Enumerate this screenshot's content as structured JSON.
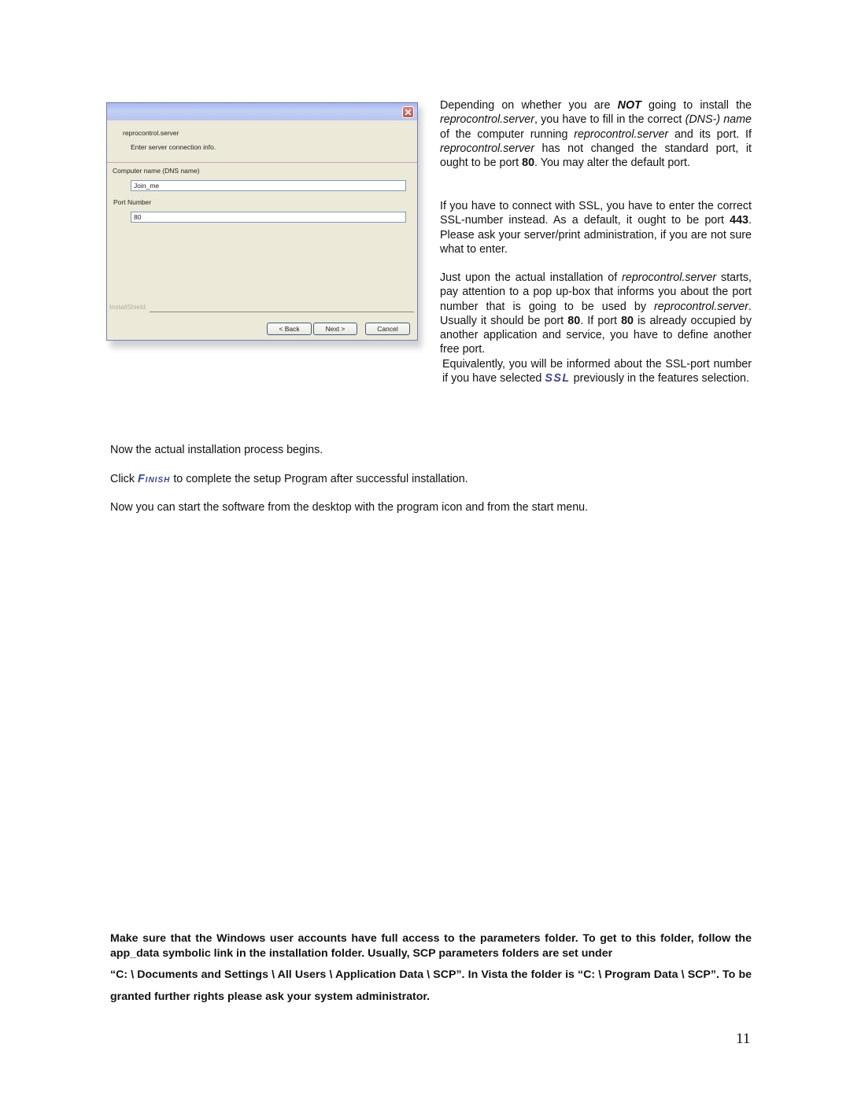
{
  "dialog": {
    "title": "reprocontrol.server",
    "subtitle": "Enter server connection info.",
    "dns_label": "Computer name (DNS name)",
    "dns_value": "Join_me",
    "port_label": "Port Number",
    "port_value": "80",
    "brand": "InstallShield",
    "back_label": "< Back",
    "next_label": "Next >",
    "cancel_label": "Cancel",
    "close_glyph": "✕"
  },
  "right_column": {
    "p1": {
      "a": "Depending on whether you are ",
      "not": "NOT",
      "b": " going to install the ",
      "rc1": "reprocontrol.server",
      "c": ", you have to fill in the correct ",
      "dns": "(DNS-) name",
      "d": " of the computer running ",
      "rc2": "reprocontrol.server",
      "e": " and its port. If ",
      "rc3": "reprocontrol.server",
      "f": " has not changed the standard port, it ought to be port ",
      "port": "80",
      "g": ". You may alter the default port."
    },
    "p2": {
      "a": "If you have to connect with SSL, you have to enter the correct SSL-number instead. As a default, it ought to be port ",
      "port": "443",
      "b": ". Please ask your server/print administration, if you are not sure what to enter."
    },
    "p3": {
      "a": "Just upon the actual installation of ",
      "rc1": "reprocontrol.server",
      "b": " starts, pay attention to a pop up-box that informs you about the port number that is going to be used by ",
      "rc2": "reprocontrol.server",
      "c": ". Usually it should be port ",
      "port1": "80",
      "d": ". If port ",
      "port2": "80",
      "e": " is already occupied by another application and service, you have to define another free port."
    },
    "p4": {
      "a": "Equivalently, you will be informed about the SSL-port number if you have selected ",
      "ssl": "SSL",
      "b": " previously in the features selection."
    }
  },
  "body": {
    "line1": "Now the actual installation process begins.",
    "line2_a": "Click ",
    "finish": "Finish",
    "line2_b": " to complete the setup Program after successful installation.",
    "line3": "Now you can start the software from the desktop with the program icon and from the start menu."
  },
  "notice": {
    "line1": "Make sure that the Windows user accounts have full access to the parameters folder. To get to this folder, follow the app_data symbolic link in the installation folder. Usually, SCP parameters folders are set under",
    "line2": "“C: \\ Documents and Settings \\ All Users \\ Application Data \\ SCP”.  In Vista the folder is “C: \\ Program Data \\ SCP”. To be granted further rights please ask your system administrator."
  },
  "page_number": "11"
}
